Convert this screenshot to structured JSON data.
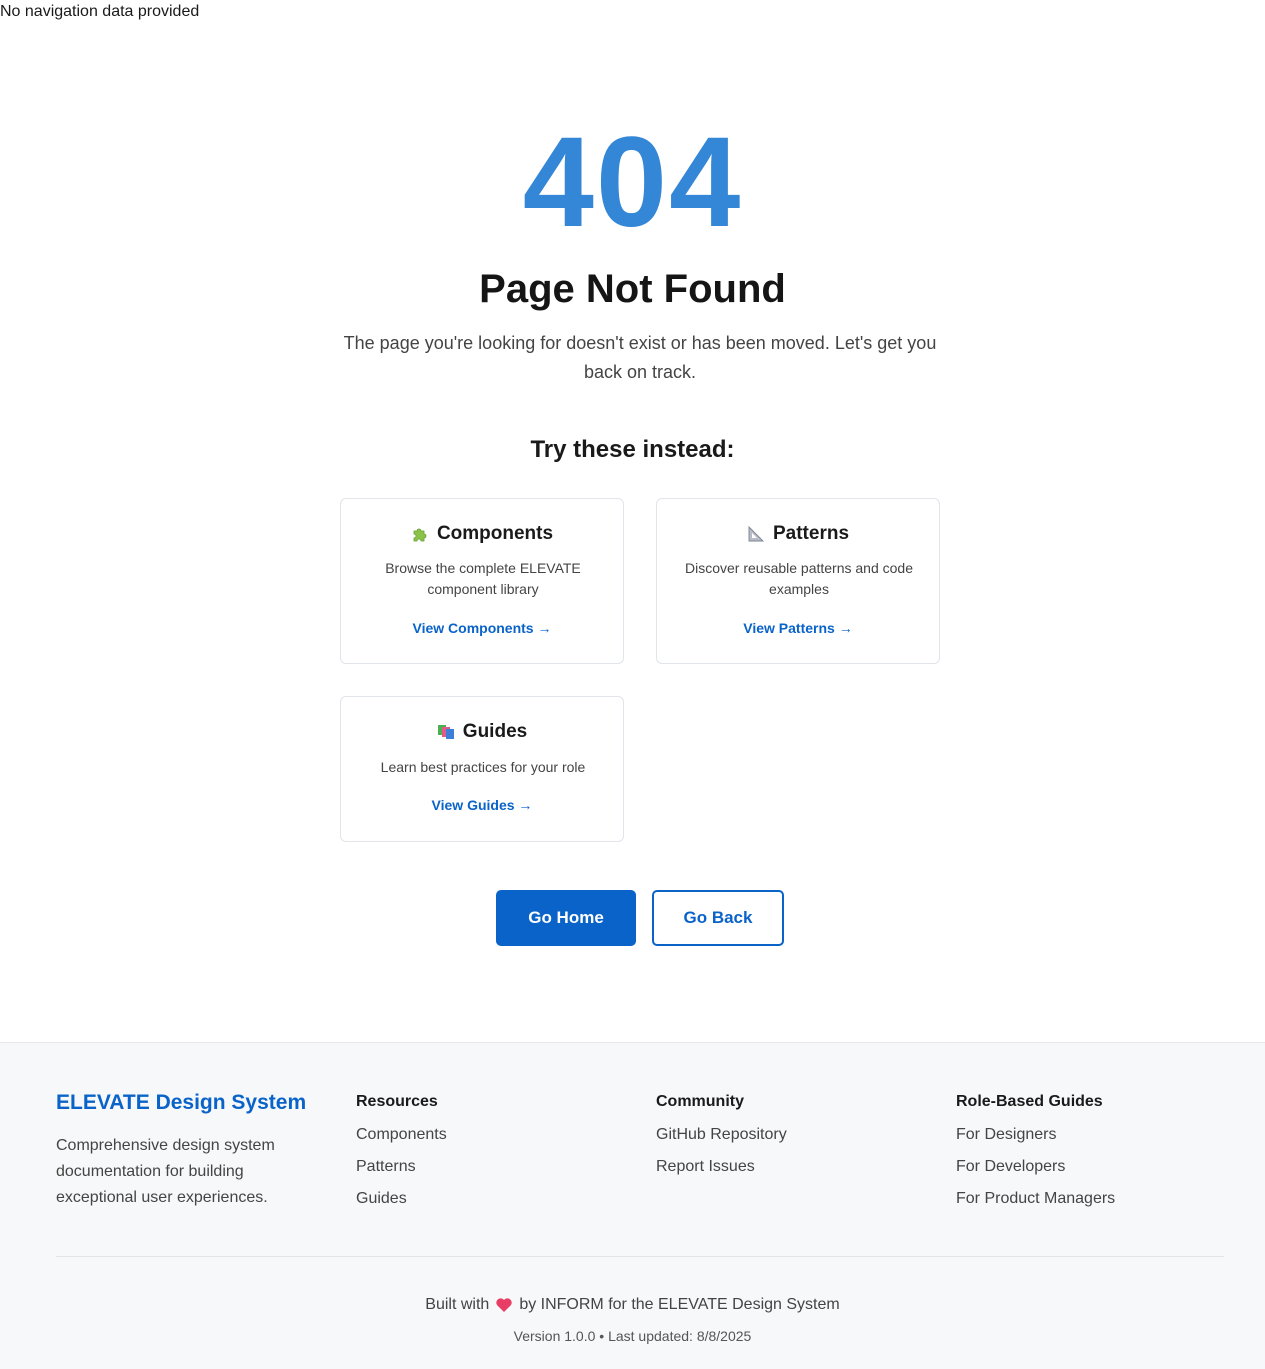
{
  "top_note": "No navigation data provided",
  "colors": {
    "accent_404": "#3486d6",
    "primary": "#0a63c9",
    "link": "#0a63c9",
    "brand": "#0a63c9",
    "heart": "#e83e66"
  },
  "error": {
    "code": "404",
    "title": "Page Not Found",
    "description": "The page you're looking for doesn't exist or has been moved. Let's get you back on track."
  },
  "suggestions": {
    "heading": "Try these instead:",
    "cards": [
      {
        "icon": "puzzle-piece-icon",
        "title": "Components",
        "description": "Browse the complete ELEVATE component library",
        "link": "View Components →"
      },
      {
        "icon": "triangular-ruler-icon",
        "title": "Patterns",
        "description": "Discover reusable patterns and code examples",
        "link": "View Patterns →"
      },
      {
        "icon": "books-icon",
        "title": "Guides",
        "description": "Learn best practices for your role",
        "link": "View Guides →"
      }
    ]
  },
  "actions": {
    "home": "Go Home",
    "back": "Go Back"
  },
  "footer": {
    "brand": "ELEVATE Design System",
    "brand_description": "Comprehensive design system documentation for building exceptional user experiences.",
    "columns": [
      {
        "title": "Resources",
        "links": [
          "Components",
          "Patterns",
          "Guides"
        ]
      },
      {
        "title": "Community",
        "links": [
          "GitHub Repository",
          "Report Issues"
        ]
      },
      {
        "title": "Role-Based Guides",
        "links": [
          "For Designers",
          "For Developers",
          "For Product Managers"
        ]
      }
    ],
    "built_prefix": "Built with",
    "built_suffix": "by INFORM for the ELEVATE Design System",
    "version_line": "Version 1.0.0 • Last updated: 8/8/2025"
  }
}
